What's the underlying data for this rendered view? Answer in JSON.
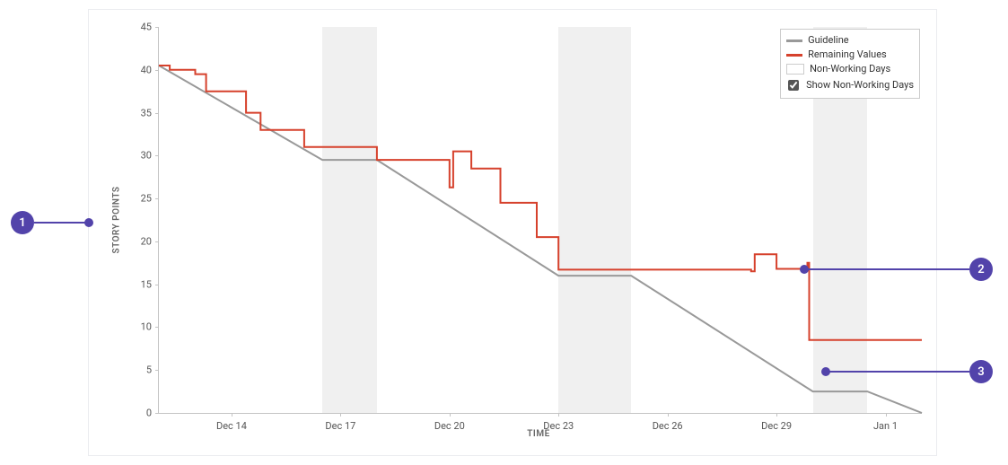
{
  "axes": {
    "ylabel": "STORY POINTS",
    "xlabel": "TIME",
    "y_ticks": [
      0,
      5,
      10,
      15,
      20,
      25,
      30,
      35,
      40,
      45
    ],
    "x_ticks": [
      "Dec 14",
      "Dec 17",
      "Dec 20",
      "Dec 23",
      "Dec 26",
      "Dec 29",
      "Jan 1"
    ]
  },
  "legend": {
    "items": [
      {
        "label": "Guideline",
        "color": "#999999",
        "type": "line"
      },
      {
        "label": "Remaining Values",
        "color": "#d6412c",
        "type": "line"
      },
      {
        "label": "Non-Working Days",
        "color": "#ffffff",
        "type": "box"
      }
    ],
    "toggle_label": "Show Non-Working Days",
    "toggle_checked": true
  },
  "callouts": [
    {
      "id": "1"
    },
    {
      "id": "2"
    },
    {
      "id": "3"
    }
  ],
  "chart_data": {
    "type": "line",
    "x": [
      12,
      12.3,
      13,
      13.3,
      14,
      14.4,
      14.5,
      14.8,
      15,
      16,
      16.5,
      18,
      19.7,
      20.0,
      20.1,
      20.3,
      20.6,
      21,
      21.4,
      22.0,
      22.4,
      22.7,
      23,
      25,
      28.3,
      28.4,
      29,
      29.8,
      29.85,
      29.9,
      33
    ],
    "x_categories": [
      "Dec 14",
      "Dec 17",
      "Dec 20",
      "Dec 23",
      "Dec 26",
      "Dec 29",
      "Jan 1"
    ],
    "series": [
      {
        "name": "Guideline",
        "color": "#999999",
        "x": [
          12,
          16.5,
          18,
          23,
          25,
          30,
          31.5,
          33
        ],
        "values": [
          40.5,
          29.5,
          29.5,
          16,
          16,
          2.5,
          2.5,
          0
        ]
      },
      {
        "name": "Remaining Values",
        "color": "#d6412c",
        "step": true,
        "x": [
          12,
          12.3,
          13,
          13.3,
          14,
          14.4,
          14.5,
          14.8,
          15,
          16,
          16.5,
          18,
          19.7,
          20.0,
          20.1,
          20.3,
          20.6,
          21,
          21.4,
          22.0,
          22.4,
          22.7,
          23,
          25,
          28.3,
          28.4,
          29,
          29.8,
          29.85,
          29.9,
          33
        ],
        "values": [
          40.5,
          40,
          39.5,
          37.5,
          37.5,
          35,
          35,
          33,
          33,
          31,
          31,
          29.5,
          29.5,
          26.3,
          30.5,
          30.5,
          28.5,
          28.5,
          24.5,
          24.5,
          20.5,
          20.5,
          16.7,
          16.7,
          16.5,
          18.5,
          16.8,
          16.8,
          17.5,
          8.5,
          8.5
        ]
      }
    ],
    "non_working_bands": [
      {
        "from": 16.5,
        "to": 18.0
      },
      {
        "from": 23.0,
        "to": 25.0
      },
      {
        "from": 30.0,
        "to": 31.5
      }
    ],
    "title": "",
    "xlabel": "TIME",
    "ylabel": "STORY POINTS",
    "xlim": [
      12,
      33
    ],
    "ylim": [
      0,
      45
    ]
  }
}
